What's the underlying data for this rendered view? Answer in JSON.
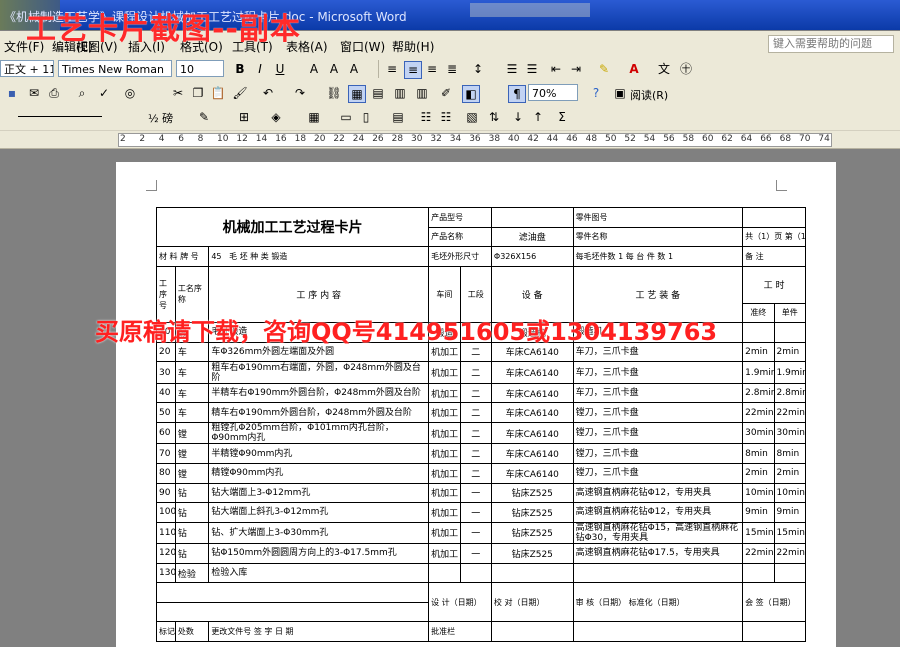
{
  "window": {
    "title": "《机械制造工艺学》课程设计机械加工工艺过程卡片.doc - Microsoft Word",
    "overlay_title": "工艺卡片截图--副本"
  },
  "menu": {
    "items": [
      "文件(F)",
      "编辑(E)",
      "视图(V)",
      "插入(I)",
      "格式(O)",
      "工具(T)",
      "表格(A)",
      "窗口(W)",
      "帮助(H)"
    ],
    "help_placeholder": "键入需要帮助的问题"
  },
  "toolbar": {
    "style_box": "正文 + 11 磅",
    "font_box": "Times New Roman",
    "size_box": "10",
    "zoom_box": "70%",
    "read_label": "阅读(R)",
    "line_box": "½ 磅"
  },
  "ruler": {
    "ticks": [
      "2",
      "2",
      "4",
      "6",
      "8",
      "10",
      "12",
      "14",
      "16",
      "18",
      "20",
      "22",
      "24",
      "26",
      "28",
      "30",
      "32",
      "34",
      "36",
      "38",
      "40",
      "42",
      "44",
      "46",
      "48",
      "50",
      "52",
      "54",
      "56",
      "58",
      "60",
      "62",
      "64",
      "66",
      "68",
      "70",
      "74"
    ]
  },
  "watermark": "买原稿请下载，咨询QQ号414951605或1304139763",
  "card": {
    "title": "机械加工工艺过程卡片",
    "product_model_label": "产品型号",
    "part_no_label": "零件图号",
    "product_name_label": "产品名称",
    "product_name": "滤油盘",
    "part_name_label": "零件名称",
    "part_name": "滤油盘",
    "total_pages": "共（1）页",
    "page_no": "第（1）页",
    "material_label": "材 料 牌 号",
    "material": "45",
    "blank_type_label": "毛 坯 种 类",
    "blank_type": "锻造",
    "blank_size_label": "毛坯外形尺寸",
    "blank_size": "Φ326X156",
    "per_blank_label": "每毛坯件数",
    "per_blank": "1",
    "per_unit_label": "每 台 件 数",
    "per_unit": "1",
    "remarks_label": "备 注",
    "head": {
      "op_no": "工序号",
      "op_name": "工名序称",
      "content": "工 序 内 容",
      "workshop": "车间",
      "section": "工段",
      "equipment": "设 备",
      "tooling": "工 艺 装 备",
      "hours": "工 时",
      "prep": "准终",
      "unit": "单件"
    },
    "rows": [
      {
        "no": "10",
        "name": "锻",
        "content": "毛坯锻造",
        "ws": "锻造",
        "sec": "",
        "eq": "锻造机",
        "tool": "锻造机",
        "prep": "",
        "unit": ""
      },
      {
        "no": "20",
        "name": "车",
        "content": "车Φ326mm外圆左端面及外圆",
        "ws": "机加工",
        "sec": "二",
        "eq": "车床CA6140",
        "tool": "车刀，三爪卡盘",
        "prep": "2min",
        "unit": "2min"
      },
      {
        "no": "30",
        "name": "车",
        "content": "粗车右Φ190mm右端面，外圆，Φ248mm外圆及台阶",
        "ws": "机加工",
        "sec": "二",
        "eq": "车床CA6140",
        "tool": "车刀，三爪卡盘",
        "prep": "1.9min",
        "unit": "1.9min"
      },
      {
        "no": "40",
        "name": "车",
        "content": "半精车右Φ190mm外圆台阶，Φ248mm外圆及台阶",
        "ws": "机加工",
        "sec": "二",
        "eq": "车床CA6140",
        "tool": "车刀，三爪卡盘",
        "prep": "2.8min",
        "unit": "2.8min"
      },
      {
        "no": "50",
        "name": "车",
        "content": "精车右Φ190mm外圆台阶，Φ248mm外圆及台阶",
        "ws": "机加工",
        "sec": "二",
        "eq": "车床CA6140",
        "tool": "镗刀，三爪卡盘",
        "prep": "22min",
        "unit": "22min"
      },
      {
        "no": "60",
        "name": "镗",
        "content": "粗镗孔Φ205mm台阶，Φ101mm内孔台阶，Φ90mm内孔",
        "ws": "机加工",
        "sec": "二",
        "eq": "车床CA6140",
        "tool": "镗刀，三爪卡盘",
        "prep": "30min",
        "unit": "30min"
      },
      {
        "no": "70",
        "name": "镗",
        "content": "半精镗Φ90mm内孔",
        "ws": "机加工",
        "sec": "二",
        "eq": "车床CA6140",
        "tool": "镗刀，三爪卡盘",
        "prep": "8min",
        "unit": "8min"
      },
      {
        "no": "80",
        "name": "镗",
        "content": "精镗Φ90mm内孔",
        "ws": "机加工",
        "sec": "二",
        "eq": "车床CA6140",
        "tool": "镗刀，三爪卡盘",
        "prep": "2min",
        "unit": "2min"
      },
      {
        "no": "90",
        "name": "钻",
        "content": "钻大端面上3-Φ12mm孔",
        "ws": "机加工",
        "sec": "一",
        "eq": "钻床Z525",
        "tool": "高速钢直柄麻花钻Φ12，专用夹具",
        "prep": "10min",
        "unit": "10min"
      },
      {
        "no": "100",
        "name": "钻",
        "content": "钻大端面上斜孔3-Φ12mm孔",
        "ws": "机加工",
        "sec": "一",
        "eq": "钻床Z525",
        "tool": "高速钢直柄麻花钻Φ12，专用夹具",
        "prep": "9min",
        "unit": "9min"
      },
      {
        "no": "110",
        "name": "钻",
        "content": "钻、扩大端面上3-Φ30mm孔",
        "ws": "机加工",
        "sec": "一",
        "eq": "钻床Z525",
        "tool": "高速钢直柄麻花钻Φ15，高速钢直柄麻花钻Φ30，专用夹具",
        "prep": "15min",
        "unit": "15min"
      },
      {
        "no": "120",
        "name": "钻",
        "content": "钻Φ150mm外圆圆周方向上的3-Φ17.5mm孔",
        "ws": "机加工",
        "sec": "一",
        "eq": "钻床Z525",
        "tool": "高速钢直柄麻花钻Φ17.5，专用夹具",
        "prep": "22min",
        "unit": "22min"
      },
      {
        "no": "130",
        "name": "检验",
        "content": "检验入库",
        "ws": "",
        "sec": "",
        "eq": "",
        "tool": "",
        "prep": "",
        "unit": ""
      }
    ],
    "footer": {
      "design": "设 计（日期）",
      "check": "校 对（日期）",
      "review": "审 核（日期）",
      "standard": "标准化（日期）",
      "sign": "会 签（日期）",
      "mark": "标记",
      "place": "处数",
      "doc_no": "更改文件号",
      "signature": "签 字",
      "date": "日 期",
      "approve": "批准栏"
    }
  }
}
